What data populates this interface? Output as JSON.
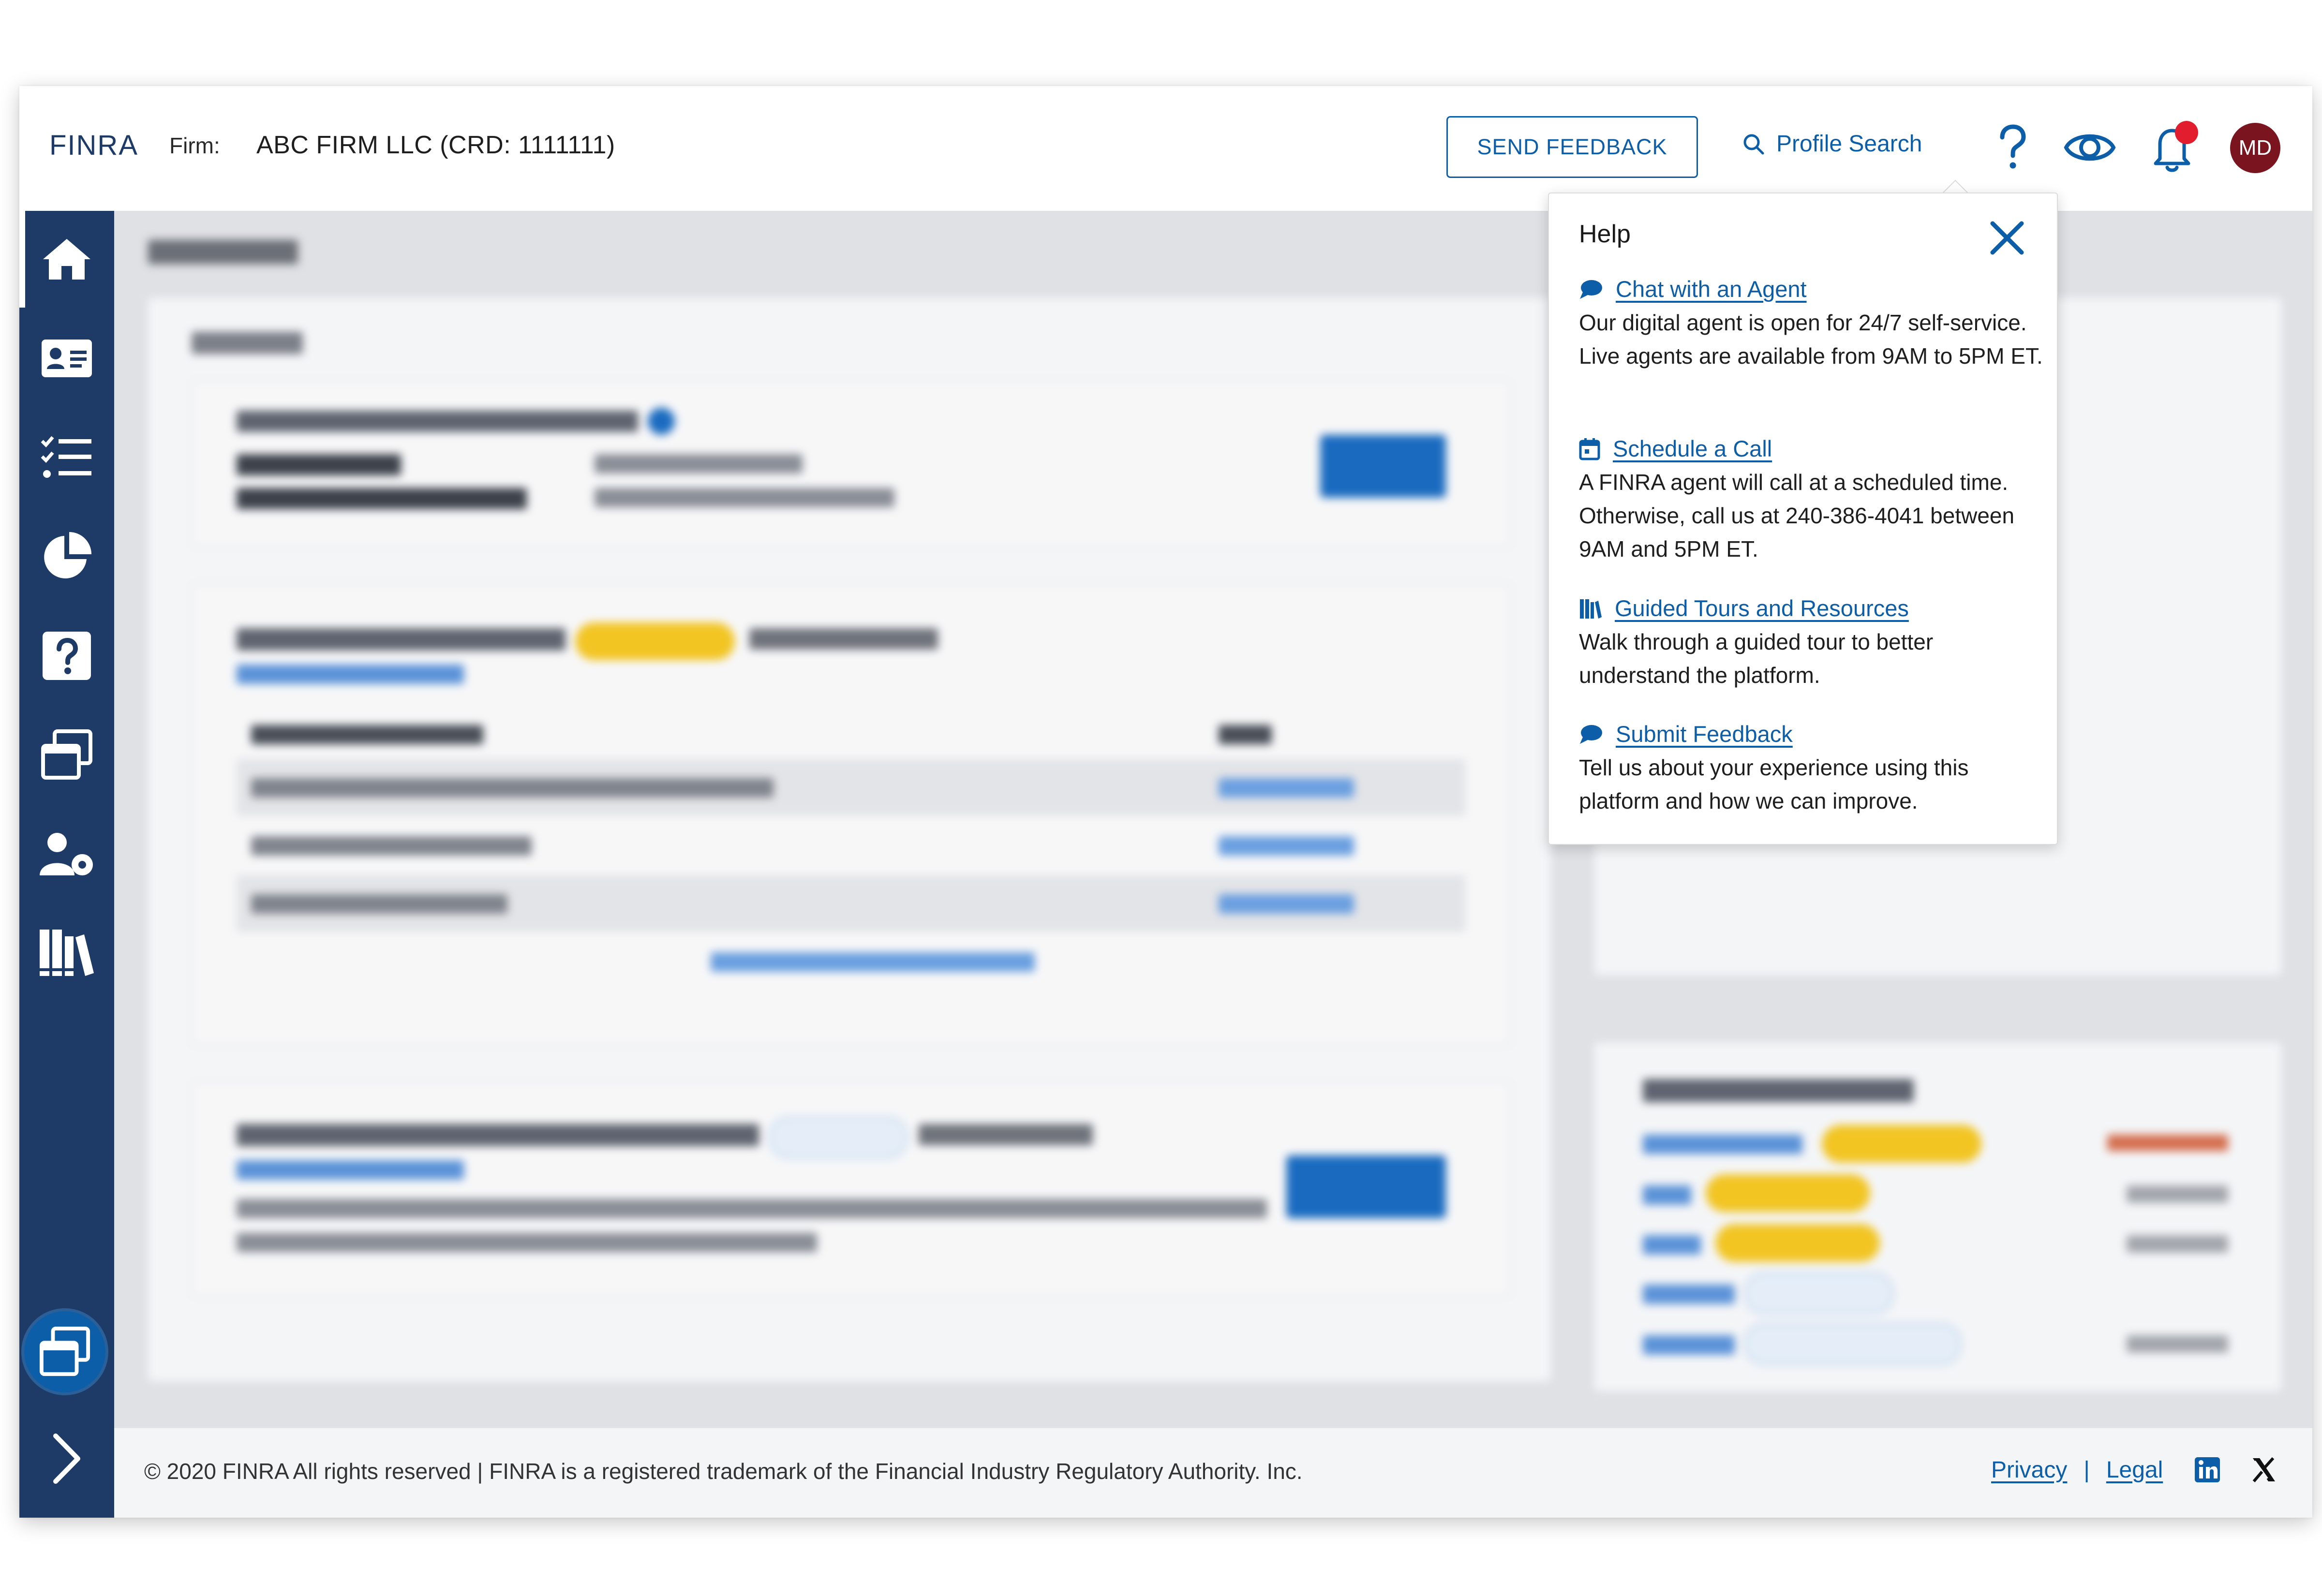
{
  "header": {
    "logo_text": "FINRA",
    "firm_label": "Firm:",
    "firm_name": "ABC FIRM LLC (CRD: 1111111)",
    "feedback_label": "SEND FEEDBACK",
    "profile_search_label": "Profile Search",
    "help_icon": "question-mark-icon",
    "view_icon": "eye-icon",
    "notification_icon": "bell-icon",
    "notification_badge_color": "#e11d2e",
    "avatar_initials": "MD",
    "avatar_color": "#7a1520"
  },
  "sidebar": {
    "items": [
      {
        "name": "home",
        "icon": "home-icon",
        "active": true
      },
      {
        "name": "profile",
        "icon": "id-card-icon"
      },
      {
        "name": "tasks",
        "icon": "checklist-icon"
      },
      {
        "name": "reports",
        "icon": "pie-chart-icon"
      },
      {
        "name": "help",
        "icon": "question-box-icon"
      },
      {
        "name": "windows",
        "icon": "stacked-windows-icon"
      },
      {
        "name": "user-settings",
        "icon": "user-gear-icon"
      },
      {
        "name": "library",
        "icon": "library-icon"
      }
    ],
    "bubble_icon": "stacked-windows-icon",
    "expand_icon": "chevron-right-icon",
    "background": "#1d3b66"
  },
  "help_popover": {
    "title": "Help",
    "items": [
      {
        "icon": "chat-bubble-icon",
        "link": "Chat with an Agent",
        "description": "Our digital agent is open for 24/7 self-service. Live agents are available from 9AM to 5PM ET."
      },
      {
        "icon": "calendar-icon",
        "link": "Schedule a Call",
        "description": "A FINRA agent will call at a scheduled time. Otherwise, call us at 240-386-4041 between 9AM and 5PM ET."
      },
      {
        "icon": "library-icon",
        "link": "Guided Tours and Resources",
        "description": "Walk through a guided tour to better understand the platform."
      },
      {
        "icon": "chat-bubble-icon",
        "link": "Submit Feedback",
        "description": "Tell us about your experience using this platform and how we can improve."
      }
    ]
  },
  "footer": {
    "copyright": "© 2020 FINRA All rights reserved | FINRA is a registered trademark of the Financial Industry Regulatory Authority. Inc.",
    "privacy": "Privacy",
    "separator": "|",
    "legal": "Legal",
    "linkedin_icon": "linkedin-icon",
    "x_icon": "x-icon"
  },
  "colors": {
    "accent": "#0d5ea8",
    "sidebar": "#1d3b66",
    "required_badge": "#f2c523"
  }
}
